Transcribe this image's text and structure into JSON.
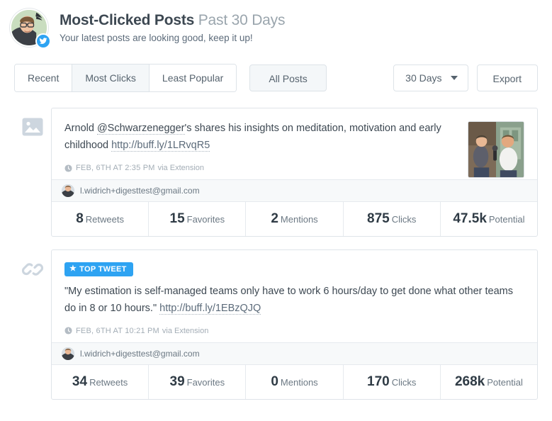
{
  "header": {
    "title": "Most-Clicked Posts",
    "subtitle": "Past 30 Days",
    "tagline": "Your latest posts are looking good, keep it up!",
    "avatar_name": "profile-avatar",
    "network_badge": "twitter-icon"
  },
  "toolbar": {
    "tabs": [
      {
        "label": "Recent",
        "active": false
      },
      {
        "label": "Most Clicks",
        "active": true
      },
      {
        "label": "Least Popular",
        "active": false
      }
    ],
    "all_posts_label": "All Posts",
    "range_label": "30 Days",
    "export_label": "Export",
    "accent_color": "#2ea3f2"
  },
  "posts": [
    {
      "type_icon": "image-icon",
      "badge": null,
      "text_parts": [
        {
          "t": "Arnold ",
          "style": "plain"
        },
        {
          "t": "@Schwarzenegger",
          "style": "mention"
        },
        {
          "t": "'s shares his insights on meditation, motivation and early childhood ",
          "style": "plain"
        },
        {
          "t": "http://buff.ly/1LRvqR5",
          "style": "link"
        }
      ],
      "timestamp": "FEB, 6TH AT 2:35 PM",
      "via": "via Extension",
      "thumbnail": "post-thumbnail-photo",
      "account": "l.widrich+digesttest@gmail.com",
      "stats": [
        {
          "num": "8",
          "label": "Retweets"
        },
        {
          "num": "15",
          "label": "Favorites"
        },
        {
          "num": "2",
          "label": "Mentions"
        },
        {
          "num": "875",
          "label": "Clicks"
        },
        {
          "num": "47.5k",
          "label": "Potential"
        }
      ]
    },
    {
      "type_icon": "link-icon",
      "badge": "TOP TWEET",
      "text_parts": [
        {
          "t": "\"My estimation is self-managed teams only have to work 6 hours/day to get done what other teams do in 8 or 10 hours.\" ",
          "style": "plain"
        },
        {
          "t": "http://buff.ly/1EBzQJQ",
          "style": "link"
        }
      ],
      "timestamp": "FEB, 6TH AT 10:21 PM",
      "via": "via Extension",
      "thumbnail": null,
      "account": "l.widrich+digesttest@gmail.com",
      "stats": [
        {
          "num": "34",
          "label": "Retweets"
        },
        {
          "num": "39",
          "label": "Favorites"
        },
        {
          "num": "0",
          "label": "Mentions"
        },
        {
          "num": "170",
          "label": "Clicks"
        },
        {
          "num": "268k",
          "label": "Potential"
        }
      ]
    }
  ]
}
